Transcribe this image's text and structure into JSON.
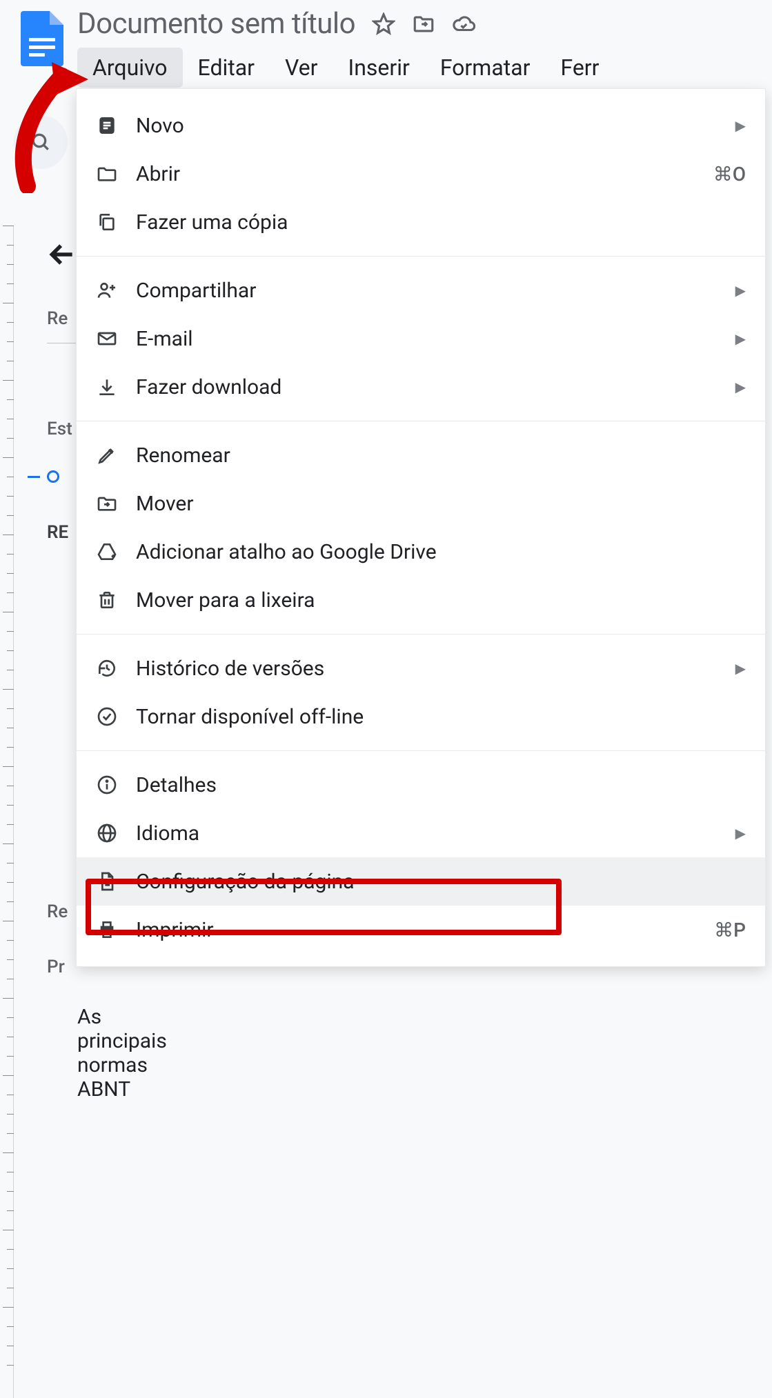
{
  "document": {
    "title": "Documento sem título"
  },
  "menubar": {
    "items": [
      "Arquivo",
      "Editar",
      "Ver",
      "Inserir",
      "Formatar",
      "Ferr"
    ]
  },
  "outline": {
    "res": "Re",
    "est": "Est",
    "re": "RE",
    "re3": "Re",
    "pr": "Pr"
  },
  "doc_body": {
    "line": "As principais normas ABNT"
  },
  "file_menu": {
    "items": [
      {
        "label": "Novo",
        "shortcut": "",
        "submenu": true
      },
      {
        "label": "Abrir",
        "shortcut": "⌘O",
        "submenu": false
      },
      {
        "label": "Fazer uma cópia",
        "shortcut": "",
        "submenu": false
      },
      {
        "label": "Compartilhar",
        "shortcut": "",
        "submenu": true
      },
      {
        "label": "E-mail",
        "shortcut": "",
        "submenu": true
      },
      {
        "label": "Fazer download",
        "shortcut": "",
        "submenu": true
      },
      {
        "label": "Renomear",
        "shortcut": "",
        "submenu": false
      },
      {
        "label": "Mover",
        "shortcut": "",
        "submenu": false
      },
      {
        "label": "Adicionar atalho ao Google Drive",
        "shortcut": "",
        "submenu": false
      },
      {
        "label": "Mover para a lixeira",
        "shortcut": "",
        "submenu": false
      },
      {
        "label": "Histórico de versões",
        "shortcut": "",
        "submenu": true
      },
      {
        "label": "Tornar disponível off-line",
        "shortcut": "",
        "submenu": false
      },
      {
        "label": "Detalhes",
        "shortcut": "",
        "submenu": false
      },
      {
        "label": "Idioma",
        "shortcut": "",
        "submenu": true
      },
      {
        "label": "Configuração da página",
        "shortcut": "",
        "submenu": false
      },
      {
        "label": "Imprimir",
        "shortcut": "⌘P",
        "submenu": false
      }
    ]
  }
}
